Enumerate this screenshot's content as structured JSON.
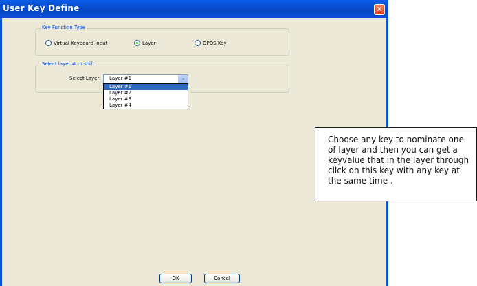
{
  "window": {
    "title": "User Key Define",
    "close_symbol": "✕"
  },
  "key_function_type": {
    "legend": "Key Function Type",
    "options": [
      {
        "label": "Virtual Keyboard Input",
        "checked": false
      },
      {
        "label": "Layer",
        "checked": true
      },
      {
        "label": "OPOS Key",
        "checked": false
      }
    ]
  },
  "layer_group": {
    "legend": "Select layer # to shift",
    "select_label": "Select Layer:",
    "selected_value": "Layer  #1",
    "dropdown_options": [
      "Layer  #1",
      "Layer  #2",
      "Layer  #3",
      "Layer  #4"
    ],
    "arrow": "⌄"
  },
  "buttons": {
    "ok": "OK",
    "cancel": "Cancel"
  },
  "annotation": {
    "text": "Choose any key  to nominate one of layer   and then you can get a keyvalue that in the layer through click on this key with any key at the same time ."
  },
  "colors": {
    "title_bar": "#0a55dc",
    "dialog_bg": "#ece9d8",
    "legend_text": "#0046d5",
    "selection": "#316ac5"
  }
}
